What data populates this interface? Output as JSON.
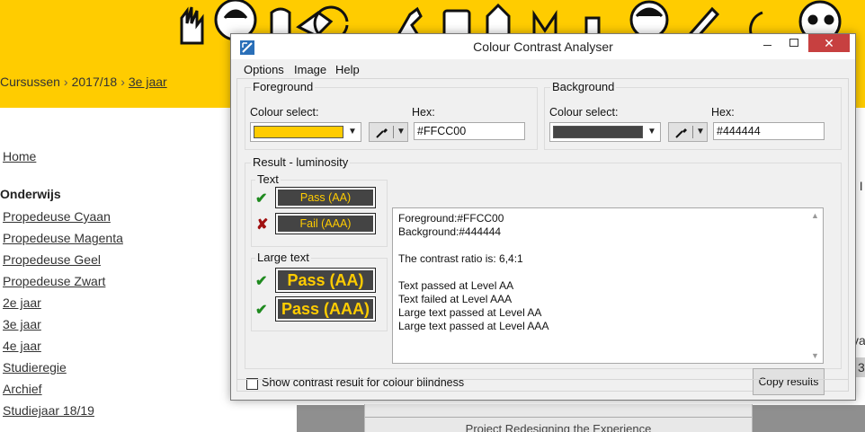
{
  "site": {
    "breadcrumb": [
      "Cursussen",
      "2017/18",
      "3e jaar"
    ],
    "nav": {
      "home": "Home",
      "section_heading": "Onderwijs",
      "items": [
        "Propedeuse Cyaan",
        "Propedeuse Magenta",
        "Propedeuse Geel",
        "Propedeuse Zwart",
        "2e jaar",
        "3e jaar",
        "4e jaar",
        "Studieregie",
        "Archief",
        "Studiejaar 18/19"
      ]
    },
    "edge_fragments": [
      ". I",
      "va",
      "3"
    ],
    "card_text": "Project Redesigning the Experience",
    "header_color": "#FFCC00"
  },
  "window": {
    "title": "Colour Contrast Analyser",
    "controls": {
      "minimize": "",
      "maximize": "",
      "close": "✕"
    },
    "menu": [
      "Options",
      "Image",
      "Help"
    ],
    "foreground": {
      "group_label": "Foreground",
      "colour_select_label": "Colour select:",
      "hex_label": "Hex:",
      "hex_value": "#FFCC00",
      "swatch_color": "#FFCC00"
    },
    "background": {
      "group_label": "Background",
      "colour_select_label": "Colour select:",
      "hex_label": "Hex:",
      "hex_value": "#444444",
      "swatch_color": "#444444"
    },
    "result": {
      "group_label": "Result - luminosity",
      "text_group_label": "Text",
      "large_text_group_label": "Large text",
      "text_pass_aa": "Pass (AA)",
      "text_fail_aaa": "Fail (AAA)",
      "large_pass_aa": "Pass (AA)",
      "large_pass_aaa": "Pass (AAA)",
      "pass_icon": "check-icon",
      "fail_icon": "cross-icon",
      "details": [
        "Foreground:#FFCC00",
        "Background:#444444",
        "",
        "The contrast ratio is: 6,4:1",
        "",
        "Text passed at Level AA",
        "Text failed at Level AAA",
        "Large text passed at Level AA",
        "Large text passed at Level AAA"
      ]
    },
    "colour_blindness_label": "Show contrast result for colour blindness",
    "colour_blindness_checked": false,
    "copy_button": "Copy results"
  }
}
